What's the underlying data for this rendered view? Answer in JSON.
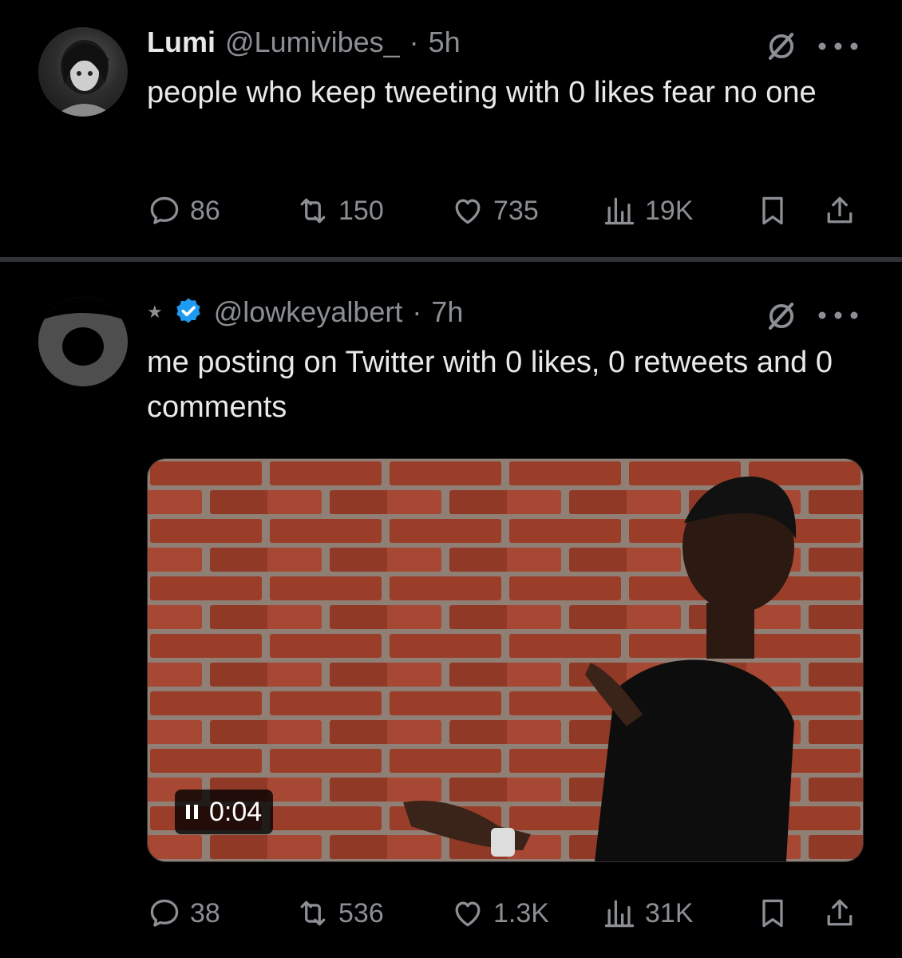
{
  "tweets": [
    {
      "display_name": "Lumi",
      "handle": "@Lumivibes_",
      "separator": "·",
      "time": "5h",
      "text": "people who keep tweeting with 0 likes fear no one",
      "stats": {
        "replies": "86",
        "retweets": "150",
        "likes": "735",
        "views": "19K"
      }
    },
    {
      "display_name": "★",
      "verified": true,
      "handle": "@lowkeyalbert",
      "separator": "·",
      "time": "7h",
      "text": "me posting on Twitter with 0 likes, 0 retweets and 0 comments",
      "video": {
        "time_label": "0:04",
        "state": "playing"
      },
      "stats": {
        "replies": "38",
        "retweets": "536",
        "likes": "1.3K",
        "views": "31K"
      }
    }
  ],
  "icons": [
    "grok-icon",
    "more-icon",
    "reply-icon",
    "retweet-icon",
    "like-icon",
    "views-icon",
    "bookmark-icon",
    "share-icon",
    "verified-badge-icon",
    "pause-icon"
  ],
  "colors": {
    "background": "#000000",
    "text": "#e7e9ea",
    "muted": "#8b8f94",
    "verified": "#1d9bf0",
    "divider": "#2f3336"
  }
}
